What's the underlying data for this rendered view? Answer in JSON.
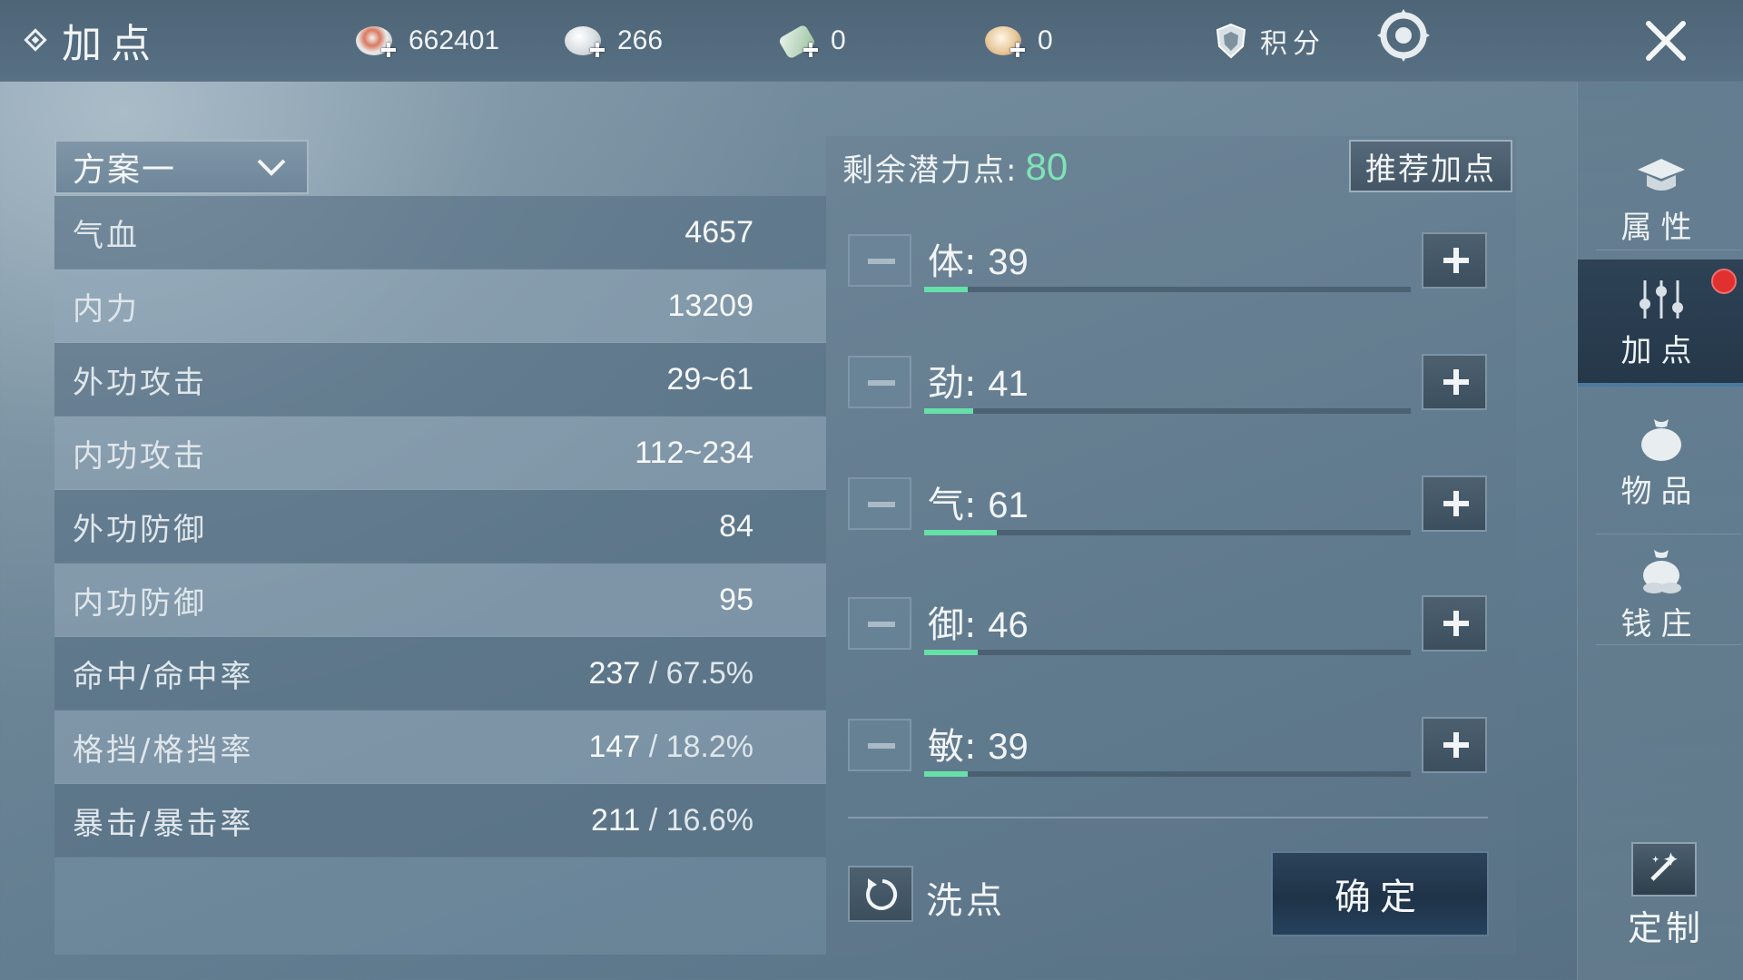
{
  "header": {
    "title": "加点",
    "currencies": [
      {
        "icon": "coin-icon",
        "value": "662401"
      },
      {
        "icon": "silver-ingot-icon",
        "value": "266"
      },
      {
        "icon": "ticket-icon",
        "value": "0"
      },
      {
        "icon": "gold-ingot-icon",
        "value": "0"
      }
    ],
    "score_label": "积分",
    "settings_icon": "settings-icon",
    "close_icon": "close-icon"
  },
  "plan": {
    "selected": "方案一"
  },
  "stats": [
    {
      "label": "气血",
      "value": "4657",
      "rate": ""
    },
    {
      "label": "内力",
      "value": "13209",
      "rate": ""
    },
    {
      "label": "外功攻击",
      "value": "29~61",
      "rate": ""
    },
    {
      "label": "内功攻击",
      "value": "112~234",
      "rate": ""
    },
    {
      "label": "外功防御",
      "value": "84",
      "rate": ""
    },
    {
      "label": "内功防御",
      "value": "95",
      "rate": ""
    },
    {
      "label": "命中/命中率",
      "value": "237",
      "rate": " / 67.5%"
    },
    {
      "label": "格挡/格挡率",
      "value": "147",
      "rate": " / 18.2%"
    },
    {
      "label": "暴击/暴击率",
      "value": "211",
      "rate": " / 16.6%"
    }
  ],
  "allocation": {
    "remaining_label": "剩余潜力点:",
    "remaining_value": "80",
    "recommend_label": "推荐加点",
    "attributes": [
      {
        "name": "体",
        "sep": ":",
        "value": "39",
        "level": 0.09
      },
      {
        "name": "劲",
        "sep": ":",
        "value": "41",
        "level": 0.1
      },
      {
        "name": "气",
        "sep": ":",
        "value": "61",
        "level": 0.15
      },
      {
        "name": "御",
        "sep": ":",
        "value": "46",
        "level": 0.11
      },
      {
        "name": "敏",
        "sep": ":",
        "value": "39",
        "level": 0.09
      }
    ],
    "reset_label": "洗点",
    "confirm_label": "确定"
  },
  "sidebar": {
    "items": [
      {
        "label": "属性",
        "icon": "attribute-hat-icon"
      },
      {
        "label": "加点",
        "icon": "sliders-icon"
      },
      {
        "label": "物品",
        "icon": "item-bag-icon"
      },
      {
        "label": "钱庄",
        "icon": "money-bag-icon"
      }
    ],
    "custom_label": "定制"
  },
  "colors": {
    "accent_green": "#66e0a8",
    "remaining_green": "#7ee3b7",
    "notification_red": "#e03030"
  }
}
